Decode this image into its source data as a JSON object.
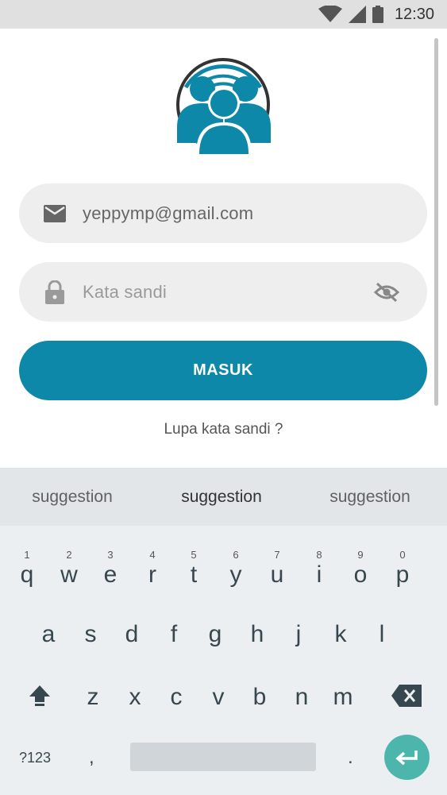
{
  "status_bar": {
    "time": "12:30",
    "icons": [
      "wifi-icon",
      "signal-icon",
      "battery-icon"
    ]
  },
  "logo": {
    "icon": "group-users-icon",
    "color": "#0e88a8"
  },
  "login": {
    "email_value": "yeppymp@gmail.com",
    "password_placeholder": "Kata sandi",
    "submit_label": "MASUK",
    "forgot_label": "Lupa kata sandi ?"
  },
  "keyboard": {
    "suggestions": [
      "suggestion",
      "suggestion",
      "suggestion"
    ],
    "row1": [
      {
        "key": "q",
        "hint": "1"
      },
      {
        "key": "w",
        "hint": "2"
      },
      {
        "key": "e",
        "hint": "3"
      },
      {
        "key": "r",
        "hint": "4"
      },
      {
        "key": "t",
        "hint": "5"
      },
      {
        "key": "y",
        "hint": "6"
      },
      {
        "key": "u",
        "hint": "7"
      },
      {
        "key": "i",
        "hint": "8"
      },
      {
        "key": "o",
        "hint": "9"
      },
      {
        "key": "p",
        "hint": "0"
      }
    ],
    "row2": [
      "a",
      "s",
      "d",
      "f",
      "g",
      "h",
      "j",
      "k",
      "l"
    ],
    "row3": [
      "z",
      "x",
      "c",
      "v",
      "b",
      "n",
      "m"
    ],
    "symbols_label": "?123",
    "comma": ",",
    "period": "."
  },
  "colors": {
    "accent": "#0e88a8",
    "enter": "#4db6ac",
    "field_bg": "#eeeeee"
  }
}
